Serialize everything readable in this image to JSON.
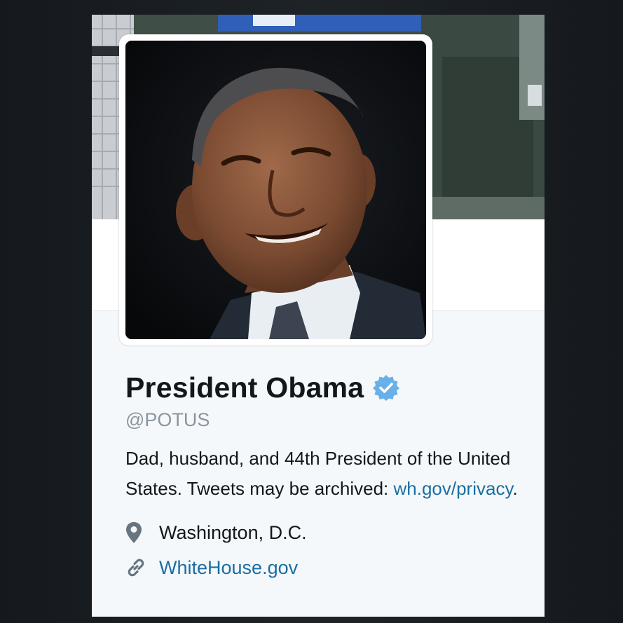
{
  "profile": {
    "name": "President Obama",
    "verified": true,
    "handle": "@POTUS",
    "bio_text": "Dad, husband, and 44th President of the United States. Tweets may be archived: ",
    "bio_link": "wh.gov/privacy",
    "bio_end": ".",
    "location": "Washington, D.C.",
    "website": "WhiteHouse.gov"
  },
  "icons": {
    "verified": "verified-badge-icon",
    "location": "map-pin-icon",
    "website": "link-icon"
  },
  "colors": {
    "name": "#14171a",
    "handle": "#8a95a0",
    "link": "#1b6ea3",
    "verified": "#67b0e8",
    "card_background": "#f5f8fa"
  }
}
